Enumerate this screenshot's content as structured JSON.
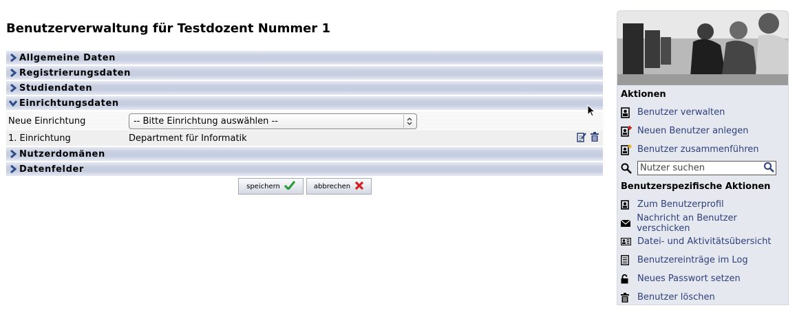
{
  "page": {
    "title": "Benutzerverwaltung für Testdozent Nummer 1"
  },
  "sections": [
    {
      "label": "Allgemeine Daten",
      "expanded": false
    },
    {
      "label": "Registrierungsdaten",
      "expanded": false
    },
    {
      "label": "Studiendaten",
      "expanded": false
    },
    {
      "label": "Einrichtungsdaten",
      "expanded": true
    },
    {
      "label": "Nutzerdomänen",
      "expanded": false
    },
    {
      "label": "Datenfelder",
      "expanded": false
    }
  ],
  "einrichtung": {
    "new_label": "Neue Einrichtung",
    "select_value": "-- Bitte Einrichtung auswählen --",
    "entry_label": "1. Einrichtung",
    "entry_value": "Department für Informatik"
  },
  "buttons": {
    "save": "speichern",
    "cancel": "abbrechen"
  },
  "sidebar": {
    "actions_heading": "Aktionen",
    "actions": [
      {
        "label": "Benutzer verwalten",
        "icon": "user-card-icon"
      },
      {
        "label": "Neuen Benutzer anlegen",
        "icon": "user-add-icon"
      },
      {
        "label": "Benutzer zusammenführen",
        "icon": "user-merge-icon"
      }
    ],
    "search_placeholder": "Nutzer suchen",
    "user_actions_heading": "Benutzerspezifische Aktionen",
    "user_actions": [
      {
        "label": "Zum Benutzerprofil",
        "icon": "profile-icon"
      },
      {
        "label": "Nachricht an Benutzer verschicken",
        "icon": "mail-icon"
      },
      {
        "label": "Datei- und Aktivitätsübersicht",
        "icon": "id-card-icon"
      },
      {
        "label": "Benutzereinträge im Log",
        "icon": "log-icon"
      },
      {
        "label": "Neues Passwort setzen",
        "icon": "lock-icon"
      },
      {
        "label": "Benutzer löschen",
        "icon": "trash-icon"
      }
    ]
  },
  "colors": {
    "link": "#2c3f7c",
    "chevron": "#2d4a8a",
    "save_check": "#2a9a3a",
    "cancel_x": "#d62020"
  }
}
